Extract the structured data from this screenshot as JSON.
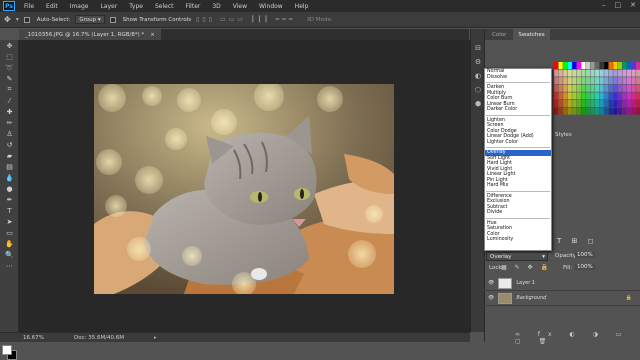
{
  "menubar": {
    "logo": "Ps",
    "items": [
      "File",
      "Edit",
      "Image",
      "Layer",
      "Type",
      "Select",
      "Filter",
      "3D",
      "View",
      "Window",
      "Help"
    ]
  },
  "options_bar": {
    "auto_select_label": "Auto-Select:",
    "auto_select_value": "Group",
    "transform_label": "Show Transform Controls",
    "mode_3d": "3D Mode:"
  },
  "document": {
    "tab_title": "_1010356.JPG @ 16.7% (Layer 1, RGB/8*) *",
    "close": "×"
  },
  "status": {
    "zoom": "16.67%",
    "doc": "Doc: 35.6M/40.6M"
  },
  "panels": {
    "tabs": [
      "Color",
      "Swatches"
    ],
    "styles_label": "Styles",
    "opacity_label": "Opacity:",
    "opacity_value": "100%",
    "fill_label": "Fill:",
    "fill_value": "100%",
    "lock_label": "Lock:"
  },
  "blend_modes": [
    [
      "Normal",
      "Dissolve"
    ],
    [
      "Darken",
      "Multiply",
      "Color Burn",
      "Linear Burn",
      "Darker Color"
    ],
    [
      "Lighten",
      "Screen",
      "Color Dodge",
      "Linear Dodge (Add)",
      "Lighter Color"
    ],
    [
      "Overlay",
      "Soft Light",
      "Hard Light",
      "Vivid Light",
      "Linear Light",
      "Pin Light",
      "Hard Mix"
    ],
    [
      "Difference",
      "Exclusion",
      "Subtract",
      "Divide"
    ],
    [
      "Hue",
      "Saturation",
      "Color",
      "Luminosity"
    ]
  ],
  "blend_selected": "Overlay",
  "layers": {
    "blend_value": "Overlay",
    "rows": [
      {
        "name": "Layer 1"
      },
      {
        "name": "Background"
      }
    ]
  },
  "colors": {
    "app_bg": "#535353",
    "canvas_bg": "#282828",
    "selection": "#2d64c8"
  }
}
